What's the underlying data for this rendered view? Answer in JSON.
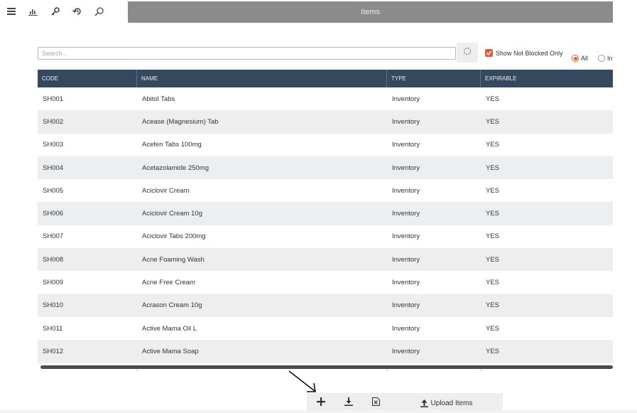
{
  "window": {
    "title": "Items"
  },
  "toolbar": {
    "icons": [
      "menu-icon",
      "bar-chart-icon",
      "key-icon",
      "history-icon",
      "search-icon"
    ]
  },
  "filters": {
    "search_placeholder": "Search ..",
    "refresh_icon": "refresh-icon",
    "show_not_blocked_label": "Show Not Blocked Only",
    "show_not_blocked_checked": true,
    "radio_all_label": "All",
    "radio_all_selected": true,
    "radio_second_label": "In",
    "accent_color": "#ee5a2a"
  },
  "table": {
    "columns": [
      "CODE",
      "NAME",
      "TYPE",
      "EXPIRABLE"
    ],
    "header_color": "#34495e",
    "rows": [
      [
        "SH001",
        "Abitol Tabs",
        "Inventory",
        "YES"
      ],
      [
        "SH002",
        "Acease (Magnesium) Tab",
        "Inventory",
        "YES"
      ],
      [
        "SH003",
        "Acefen Tabs 100mg",
        "Inventory",
        "YES"
      ],
      [
        "SH004",
        "Acetazolamide 250mg",
        "Inventory",
        "YES"
      ],
      [
        "SH005",
        "Aciclovir Cream",
        "Inventory",
        "YES"
      ],
      [
        "SH006",
        "Aciclovir Cream 10g",
        "Inventory",
        "YES"
      ],
      [
        "SH007",
        "Aciclovir Tabs 200mg",
        "Inventory",
        "YES"
      ],
      [
        "SH008",
        "Acne Foaming Wash",
        "Inventory",
        "YES"
      ],
      [
        "SH009",
        "Acne Free Cream",
        "Inventory",
        "YES"
      ],
      [
        "SH010",
        "Acrason Cream 10g",
        "Inventory",
        "YES"
      ],
      [
        "SH011",
        "Active Mama Oil L",
        "Inventory",
        "YES"
      ],
      [
        "SH012",
        "Active Mama Soap",
        "Inventory",
        "YES"
      ]
    ]
  },
  "bottom_toolbar": {
    "icons": [
      "plus-icon",
      "download-icon",
      "excel-icon"
    ],
    "upload_label": "Upload Items",
    "upload_icon": "upload-icon"
  }
}
